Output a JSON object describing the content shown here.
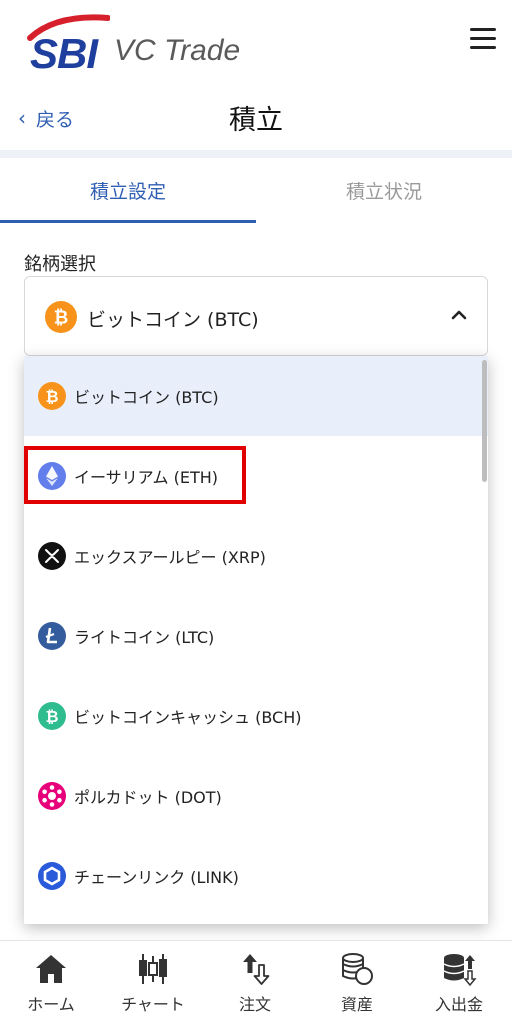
{
  "header": {
    "logo_sbi": "SBI",
    "logo_vc": "VC Trade"
  },
  "nav": {
    "back_label": "戻る",
    "back_chevron": "‹",
    "title": "積立"
  },
  "tabs": [
    {
      "label": "積立設定",
      "active": true
    },
    {
      "label": "積立状況",
      "active": false
    }
  ],
  "field": {
    "label": "銘柄選択",
    "selected": "ビットコイン (BTC)"
  },
  "options": [
    {
      "label": "ビットコイン (BTC)",
      "icon": "bitcoin-icon",
      "color": "#f7931a",
      "selected": true
    },
    {
      "label": "イーサリアム (ETH)",
      "icon": "ethereum-icon",
      "color": "#627eea",
      "highlighted": true
    },
    {
      "label": "エックスアールピー (XRP)",
      "icon": "xrp-icon",
      "color": "#111111"
    },
    {
      "label": "ライトコイン (LTC)",
      "icon": "litecoin-icon",
      "color": "#345d9d"
    },
    {
      "label": "ビットコインキャッシュ (BCH)",
      "icon": "bitcoin-cash-icon",
      "color": "#2fbc8f"
    },
    {
      "label": "ポルカドット (DOT)",
      "icon": "polkadot-icon",
      "color": "#e6007a"
    },
    {
      "label": "チェーンリンク (LINK)",
      "icon": "chainlink-icon",
      "color": "#2a5ada"
    }
  ],
  "bottom_nav": [
    {
      "label": "ホーム",
      "icon": "home-icon"
    },
    {
      "label": "チャート",
      "icon": "chart-icon"
    },
    {
      "label": "注文",
      "icon": "order-icon"
    },
    {
      "label": "資産",
      "icon": "assets-icon"
    },
    {
      "label": "入出金",
      "icon": "deposit-withdraw-icon"
    }
  ],
  "colors": {
    "accent": "#2f5fb3",
    "highlight": "#e00000",
    "selected_bg": "#e8effb"
  }
}
